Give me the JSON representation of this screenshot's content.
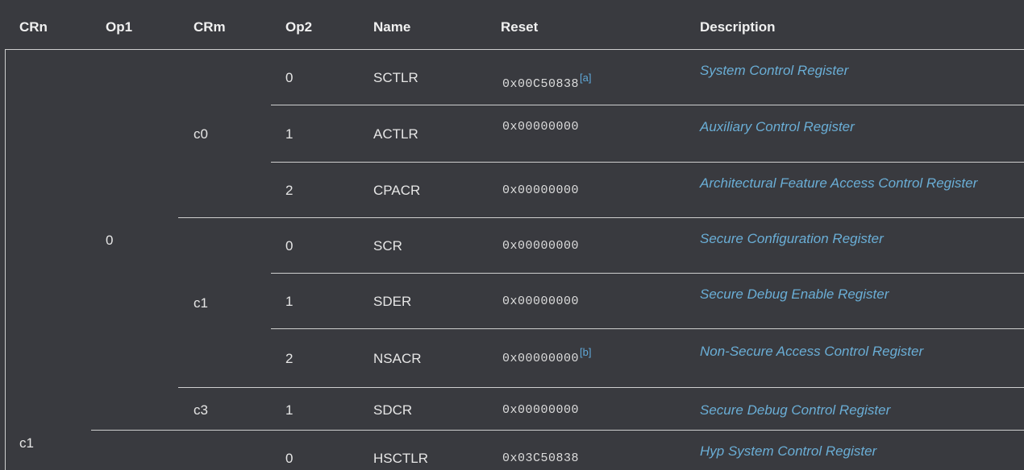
{
  "headers": {
    "crn": "CRn",
    "op1": "Op1",
    "crm": "CRm",
    "op2": "Op2",
    "name": "Name",
    "reset": "Reset",
    "description": "Description"
  },
  "groups": {
    "crn_c1": "c1",
    "op1_0": "0",
    "crm_c0": "c0",
    "crm_c1": "c1",
    "crm_c3": "c3"
  },
  "rows": [
    {
      "op2": "0",
      "name": "SCTLR",
      "reset": "0x00C50838",
      "note": "[a]",
      "description": "System Control Register"
    },
    {
      "op2": "1",
      "name": "ACTLR",
      "reset": "0x00000000",
      "note": "",
      "description": "Auxiliary Control Register"
    },
    {
      "op2": "2",
      "name": "CPACR",
      "reset": "0x00000000",
      "note": "",
      "description": "Architectural Feature Access Control Register"
    },
    {
      "op2": "0",
      "name": "SCR",
      "reset": "0x00000000",
      "note": "",
      "description": "Secure Configuration Register"
    },
    {
      "op2": "1",
      "name": "SDER",
      "reset": "0x00000000",
      "note": "",
      "description": "Secure Debug Enable Register"
    },
    {
      "op2": "2",
      "name": "NSACR",
      "reset": "0x00000000",
      "note": "[b]",
      "description": "Non-Secure Access Control Register"
    },
    {
      "op2": "1",
      "name": "SDCR",
      "reset": "0x00000000",
      "note": "",
      "description": "Secure Debug Control Register"
    },
    {
      "op2": "0",
      "name": "HSCTLR",
      "reset": "0x03C50838",
      "note": "",
      "description": "Hyp System Control Register"
    }
  ]
}
